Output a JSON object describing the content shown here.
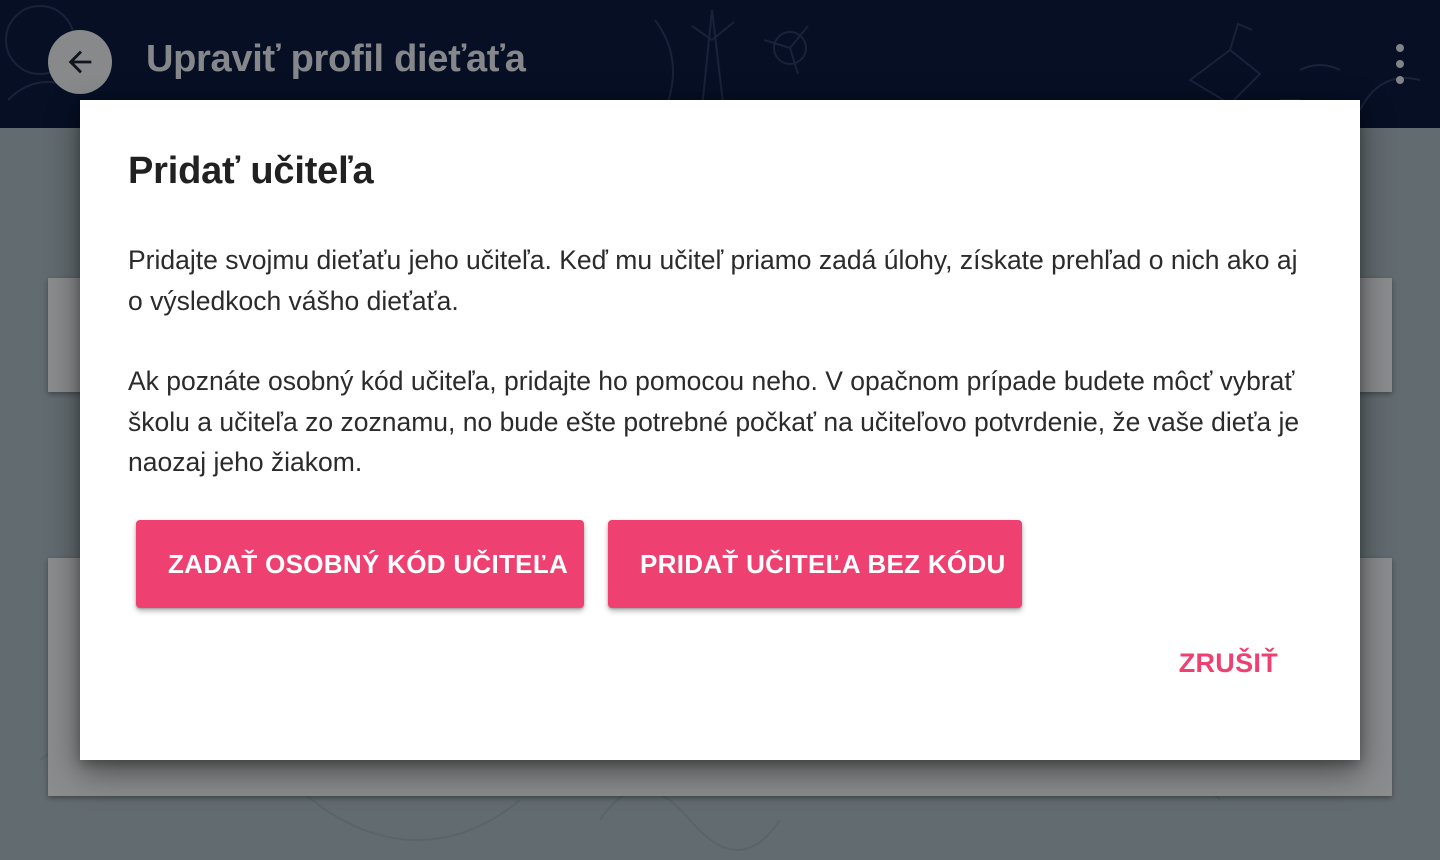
{
  "app_bar": {
    "title": "Upraviť profil dieťaťa",
    "back_icon": "arrow-back-icon",
    "menu_icon": "more-vert-icon",
    "color": "#0b1a3f"
  },
  "dialog": {
    "title": "Pridať učiteľa",
    "paragraphs": [
      "Pridajte svojmu dieťaťu jeho učiteľa. Keď mu učiteľ priamo zadá úlohy, získate prehľad o nich ako aj o výsledkoch vášho dieťaťa.",
      "Ak poznáte osobný kód učiteľa, pridajte ho pomocou neho. V opačnom prípade budete môcť vybrať školu a učiteľa zo zoznamu, no bude ešte potrebné počkať na učiteľovo potvrdenie, že vaše dieťa je naozaj jeho žiakom."
    ],
    "buttons": {
      "enter_code": "ZADAŤ OSOBNÝ KÓD UČITEĽA",
      "add_without_code": "PRIDAŤ UČITEĽA BEZ KÓDU",
      "cancel": "ZRUŠIŤ"
    },
    "accent_color": "#ee4071"
  }
}
